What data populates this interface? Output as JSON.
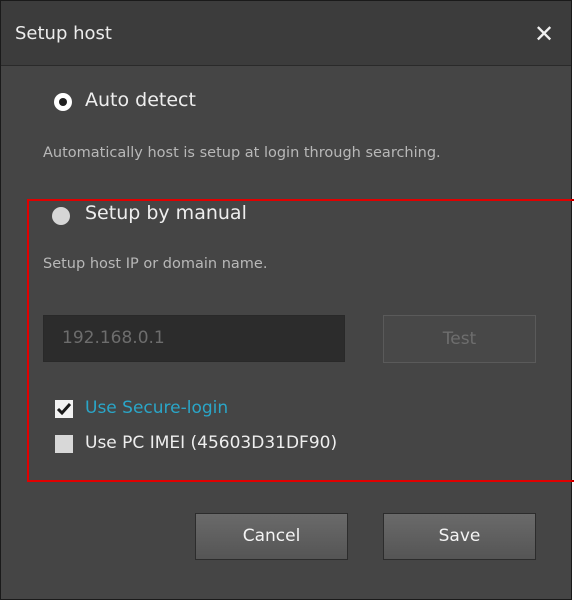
{
  "dialog": {
    "title": "Setup host",
    "close_glyph": "✕"
  },
  "auto_detect": {
    "label": "Auto detect",
    "selected": true,
    "description": "Automatically host is setup at login through searching."
  },
  "manual": {
    "label": "Setup by manual",
    "selected": false,
    "description": "Setup host IP or domain name.",
    "ip_placeholder": "192.168.0.1",
    "test_label": "Test"
  },
  "options": {
    "secure_login": {
      "label": "Use Secure-login",
      "checked": true,
      "color": "#2aa6c8"
    },
    "pc_imei": {
      "label": "Use PC IMEI (45603D31DF90)",
      "checked": false
    }
  },
  "buttons": {
    "cancel": "Cancel",
    "save": "Save"
  },
  "colors": {
    "dialog_bg": "#454545",
    "titlebar_bg": "#3c3c3c",
    "highlight_border": "#e00000",
    "link": "#2aa6c8"
  },
  "icons": {
    "close": "close-icon",
    "radio_selected": "radio-selected-icon",
    "radio_unselected": "radio-unselected-icon",
    "check": "checkmark-icon"
  }
}
